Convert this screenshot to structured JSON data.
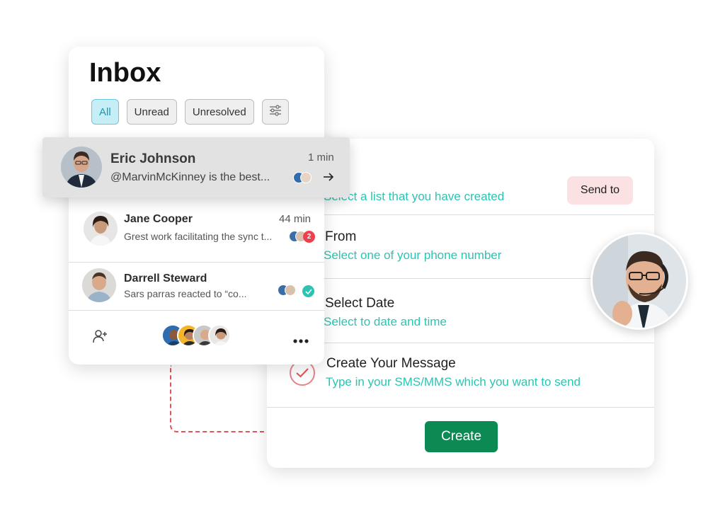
{
  "inbox": {
    "title": "Inbox",
    "filters": [
      {
        "label": "All",
        "active": true
      },
      {
        "label": "Unread",
        "active": false
      },
      {
        "label": "Unresolved",
        "active": false
      }
    ],
    "filter_settings_icon": "sliders-icon",
    "conversations": [
      {
        "name": "Eric Johnson",
        "time": "1 min",
        "preview": "@MarvinMcKinney is the best...",
        "highlighted": true,
        "indicator": "arrow-right-icon"
      },
      {
        "name": "Jane Cooper",
        "time": "44 min",
        "preview": "Grest work facilitating the sync t...",
        "badge": "2",
        "badge_color": "#ef4050"
      },
      {
        "name": "Darrell Steward",
        "time": "",
        "preview": "Sars parras reacted to “co...",
        "indicator": "check-icon",
        "indicator_color": "#2bc4b3"
      }
    ],
    "footer": {
      "add_user_icon": "add-user-icon",
      "more_icon": "more-horizontal-icon"
    }
  },
  "form": {
    "send_to_label": "Send to",
    "send_list_subtitle": "Select a list that you have created",
    "from_title": "From",
    "from_subtitle": "Select one of your phone number",
    "date_title": "Select Date",
    "date_subtitle": "Select to date and time",
    "message_title": "Create Your Message",
    "message_subtitle": "Type in your SMS/MMS which you want to send",
    "create_label": "Create"
  },
  "colors": {
    "accent_teal": "#2bc4b3",
    "create_green": "#0b8a54",
    "send_pink": "#fbe1e1",
    "active_chip": "#c6eef6",
    "connector_red": "#e2535a"
  }
}
